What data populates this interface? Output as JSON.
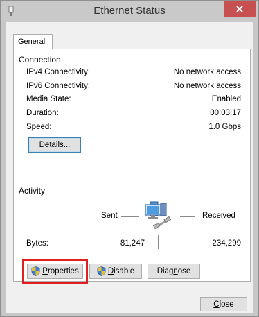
{
  "window": {
    "title": "Ethernet Status",
    "close_icon": "close-icon"
  },
  "tabs": [
    {
      "label": "General"
    }
  ],
  "connection": {
    "header": "Connection",
    "rows": [
      {
        "label": "IPv4 Connectivity:",
        "value": "No network access"
      },
      {
        "label": "IPv6 Connectivity:",
        "value": "No network access"
      },
      {
        "label": "Media State:",
        "value": "Enabled"
      },
      {
        "label": "Duration:",
        "value": "00:03:17"
      },
      {
        "label": "Speed:",
        "value": "1.0 Gbps"
      }
    ],
    "details_button": {
      "pre": "D",
      "accel": "e",
      "post": "tails..."
    }
  },
  "activity": {
    "header": "Activity",
    "sent_label": "Sent",
    "received_label": "Received",
    "bytes_label": "Bytes:",
    "bytes_sent": "81,247",
    "bytes_received": "234,299",
    "network_icon": "network-computer-icon"
  },
  "buttons": {
    "properties": {
      "accel": "P",
      "post": "roperties"
    },
    "disable": {
      "accel": "D",
      "post": "isable"
    },
    "diagnose": {
      "pre": "Diag",
      "accel": "n",
      "post": "ose"
    },
    "close": {
      "accel": "C",
      "post": "lose"
    }
  },
  "colors": {
    "highlight": "#e02020",
    "close_button": "#c75050",
    "title_bar": "#c9c9c9"
  }
}
